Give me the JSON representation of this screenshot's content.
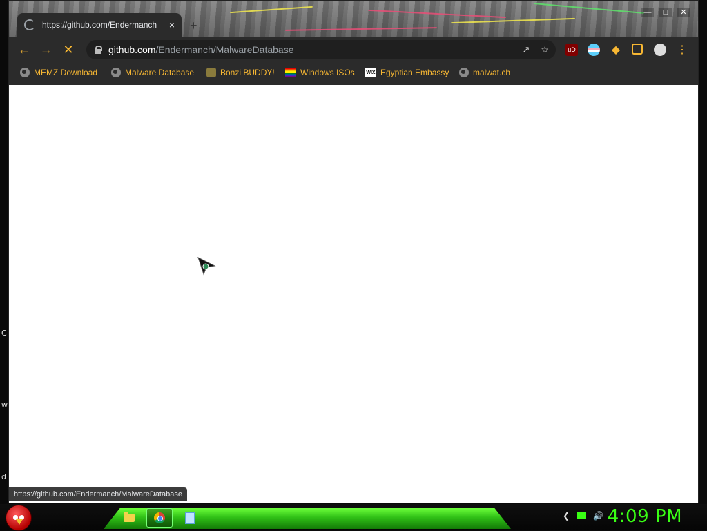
{
  "browser": {
    "tab_title": "https://github.com/Endermanch",
    "tab_close": "×",
    "new_tab": "+",
    "window_controls": {
      "minimize": "—",
      "maximize": "□",
      "close": "✕"
    },
    "omnibox": {
      "host": "github.com",
      "path": "/Endermanch/MalwareDatabase"
    },
    "bookmarks": [
      {
        "label": "MEMZ Download",
        "icon": "globe-icon"
      },
      {
        "label": "Malware Database",
        "icon": "globe-icon"
      },
      {
        "label": "Bonzi BUDDY!",
        "icon": "bonzi-icon"
      },
      {
        "label": "Windows ISOs",
        "icon": "rainbow-flag-icon"
      },
      {
        "label": "Egyptian Embassy",
        "icon": "wix-icon"
      },
      {
        "label": "malwat.ch",
        "icon": "globe-icon"
      }
    ],
    "extensions": {
      "ublock": "uD"
    },
    "status_url": "https://github.com/Endermanch/MalwareDatabase",
    "accent_color": "#f7b733"
  },
  "desktop": {
    "edge_letters": [
      "C",
      "w",
      "d"
    ]
  },
  "taskbar": {
    "clock": "4:09 PM",
    "glow_color": "#39ff14",
    "pinned": [
      "file-explorer",
      "chrome",
      "notepad"
    ]
  }
}
